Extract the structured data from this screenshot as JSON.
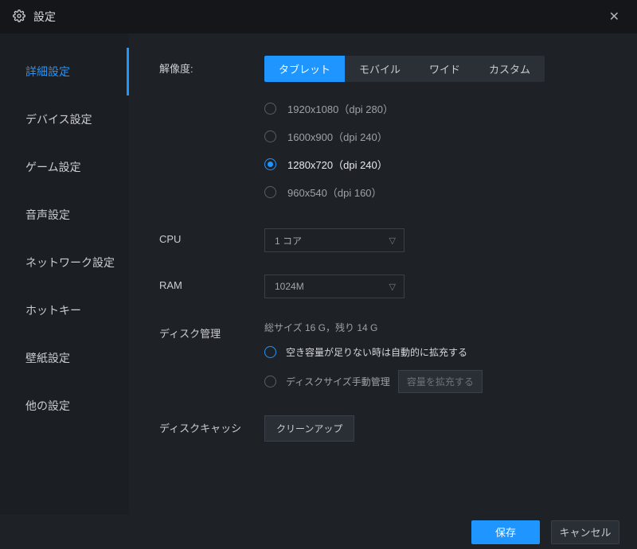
{
  "header": {
    "title": "設定"
  },
  "sidebar": {
    "items": [
      {
        "label": "詳細設定",
        "active": true
      },
      {
        "label": "デバイス設定",
        "active": false
      },
      {
        "label": "ゲーム設定",
        "active": false
      },
      {
        "label": "音声設定",
        "active": false
      },
      {
        "label": "ネットワーク設定",
        "active": false
      },
      {
        "label": "ホットキー",
        "active": false
      },
      {
        "label": "壁紙設定",
        "active": false
      },
      {
        "label": "他の設定",
        "active": false
      }
    ]
  },
  "resolution": {
    "label": "解像度:",
    "tabs": [
      {
        "label": "タブレット",
        "active": true
      },
      {
        "label": "モバイル",
        "active": false
      },
      {
        "label": "ワイド",
        "active": false
      },
      {
        "label": "カスタム",
        "active": false
      }
    ],
    "options": [
      {
        "label": "1920x1080（dpi 280）",
        "selected": false
      },
      {
        "label": "1600x900（dpi 240）",
        "selected": false
      },
      {
        "label": "1280x720（dpi 240）",
        "selected": true
      },
      {
        "label": "960x540（dpi 160）",
        "selected": false
      }
    ]
  },
  "cpu": {
    "label": "CPU",
    "value": "1 コア"
  },
  "ram": {
    "label": "RAM",
    "value": "1024M"
  },
  "disk": {
    "label": "ディスク管理",
    "status": "総サイズ 16 G，残り 14 G",
    "options": [
      {
        "label": "空き容量が足りない時は自動的に拡充する",
        "selected": true
      },
      {
        "label": "ディスクサイズ手動管理",
        "selected": false,
        "button": "容量を拡充する"
      }
    ]
  },
  "cache": {
    "label": "ディスクキャッシ",
    "button": "クリーンアップ"
  },
  "footer": {
    "save": "保存",
    "cancel": "キャンセル"
  }
}
